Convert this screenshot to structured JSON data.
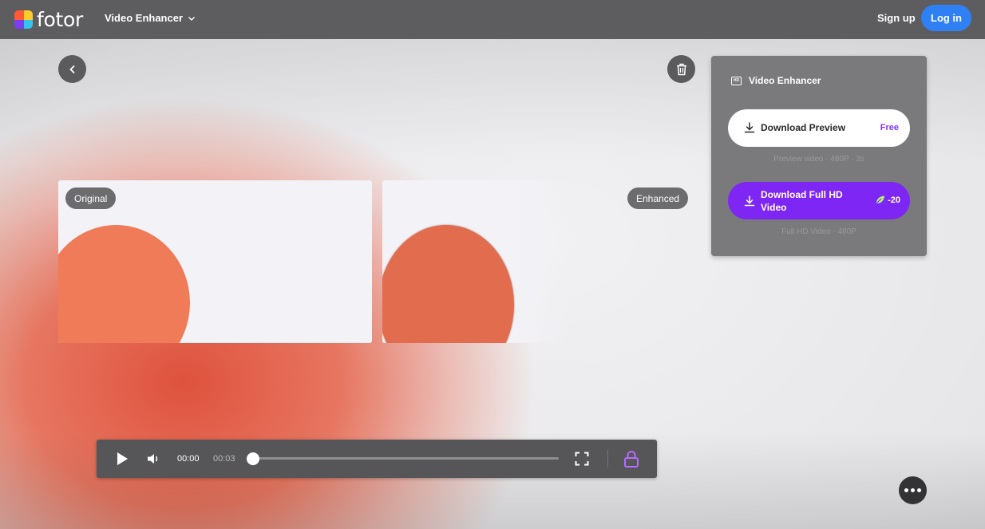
{
  "header": {
    "logo_text": "fotor",
    "product_menu_label": "Video Enhancer",
    "signup_label": "Sign up",
    "login_label": "Log in"
  },
  "preview": {
    "original_tag": "Original",
    "enhanced_tag": "Enhanced"
  },
  "panel": {
    "title": "Video Enhancer",
    "download_preview_label": "Download Preview",
    "download_preview_price": "Free",
    "preview_caption": "Preview video · 480P · 3s",
    "download_full_label": "Download Full HD Video",
    "download_full_credits": "-20",
    "full_caption": "Full HD Video · 480P"
  },
  "player": {
    "current_time": "00:00",
    "duration": "00:03",
    "progress": 0
  },
  "icons": {
    "back": "chevron-left-icon",
    "delete": "trash-icon",
    "product_menu": "chevron-down-icon",
    "hd": "hd-icon",
    "download": "download-icon",
    "credits": "leaf-icon",
    "play": "play-icon",
    "volume": "volume-icon",
    "fullscreen": "fullscreen-icon",
    "lock": "lock-icon",
    "more": "more-icon"
  },
  "colors": {
    "accent_purple": "#7e26f3",
    "login_blue": "#2f80f5",
    "free_text": "#7f34ff",
    "shape_orange": "#f07b59"
  }
}
